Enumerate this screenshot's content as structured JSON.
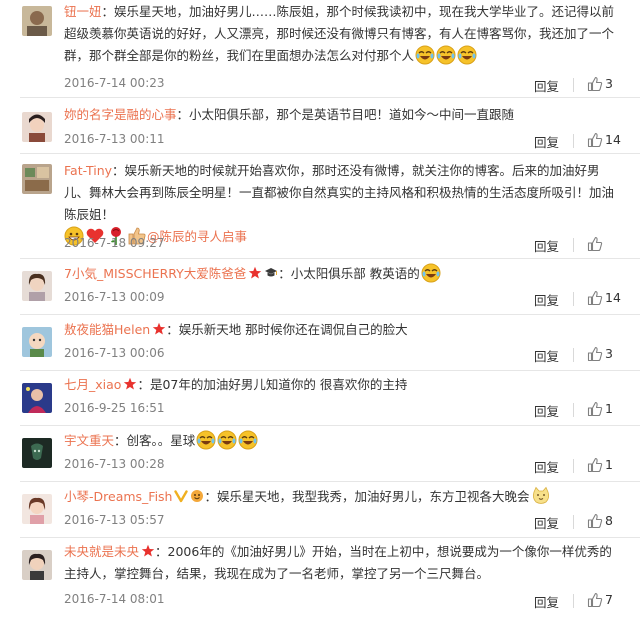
{
  "reply_label": "回复",
  "colors": {
    "name": "#eb7350",
    "text": "#333333",
    "meta": "#808080"
  },
  "comments": [
    {
      "name": "钮一妞",
      "separator": "：",
      "lines": [
        "娱乐星天地，加油好男儿……陈辰姐，那个时候我读初中，现在我大学毕业了。还记得以前",
        "超级羡慕你英语说的好好，人又漂亮，那时候还没有微博只有博客，有人在博客骂你，我还加了一个",
        "群，那个群全部是你的粉丝，我们在里面想办法怎么对付那个人"
      ],
      "emojis": [
        "laugh-cry-emoji",
        "laugh-cry-emoji",
        "laugh-cry-emoji"
      ],
      "time": "2016-7-14 00:23",
      "likes": "3"
    },
    {
      "name": "妳的名字是融的心事",
      "separator": "：",
      "lines": [
        "小太阳俱乐部，那个是英语节目吧！道如今～中间一直跟随"
      ],
      "time": "2016-7-13 00:11",
      "likes": "14"
    },
    {
      "name": "Fat-Tiny",
      "separator": "：",
      "lines": [
        "娱乐新天地的时候就开始喜欢你，那时还没有微博，就关注你的博客。后来的加油好男",
        "儿、舞林大会再到陈辰全明星！一直都被你自然真实的主持风格和积极热情的生活态度所吸引！加油",
        "陈辰姐！"
      ],
      "emojis": [
        "grin-emoji",
        "heart-emoji",
        "rose-emoji",
        "thumbs-up-emoji"
      ],
      "mention": "@陈辰的寻人启事",
      "time": "2016-7-18 09:27",
      "likes": ""
    },
    {
      "name": "7小気_MISSCHERRY大爱陈爸爸",
      "separator": "：",
      "lines": [
        "小太阳俱乐部 教英语的"
      ],
      "emojis": [
        "laugh-cry-emoji"
      ],
      "time": "2016-7-13 00:09",
      "likes": "14"
    },
    {
      "name": "敖夜能猫Helen",
      "separator": "：",
      "lines": [
        "娱乐新天地 那时候你还在调侃自己的脸大"
      ],
      "time": "2016-7-13 00:06",
      "likes": "3"
    },
    {
      "name": "七月_xiao",
      "separator": "：",
      "lines": [
        "是07年的加油好男儿知道你的  很喜欢你的主持"
      ],
      "time": "2016-9-25 16:51",
      "likes": "1"
    },
    {
      "name": "宇文重天",
      "separator": "：",
      "lines": [
        "创客。。星球"
      ],
      "emojis": [
        "laugh-cry-emoji",
        "laugh-cry-emoji",
        "laugh-cry-emoji"
      ],
      "time": "2016-7-13 00:28",
      "likes": "1"
    },
    {
      "name": "小琴-Dreams_Fish",
      "separator": "：",
      "lines": [
        "娱乐星天地，我型我秀，加油好男儿，东方卫视各大晚会"
      ],
      "emojis": [
        "cat-emoji"
      ],
      "time": "2016-7-13 05:57",
      "likes": "8"
    },
    {
      "name": "未央就是未央",
      "separator": "：",
      "lines": [
        "2006年的《加油好男儿》开始，当时在上初中，想说要成为一个像你一样优秀的",
        "主持人，掌控舞台，结果，我现在成为了一名老师，掌控了另一个三尺舞台。"
      ],
      "time": "2016-7-14 08:01",
      "likes": "7"
    }
  ]
}
